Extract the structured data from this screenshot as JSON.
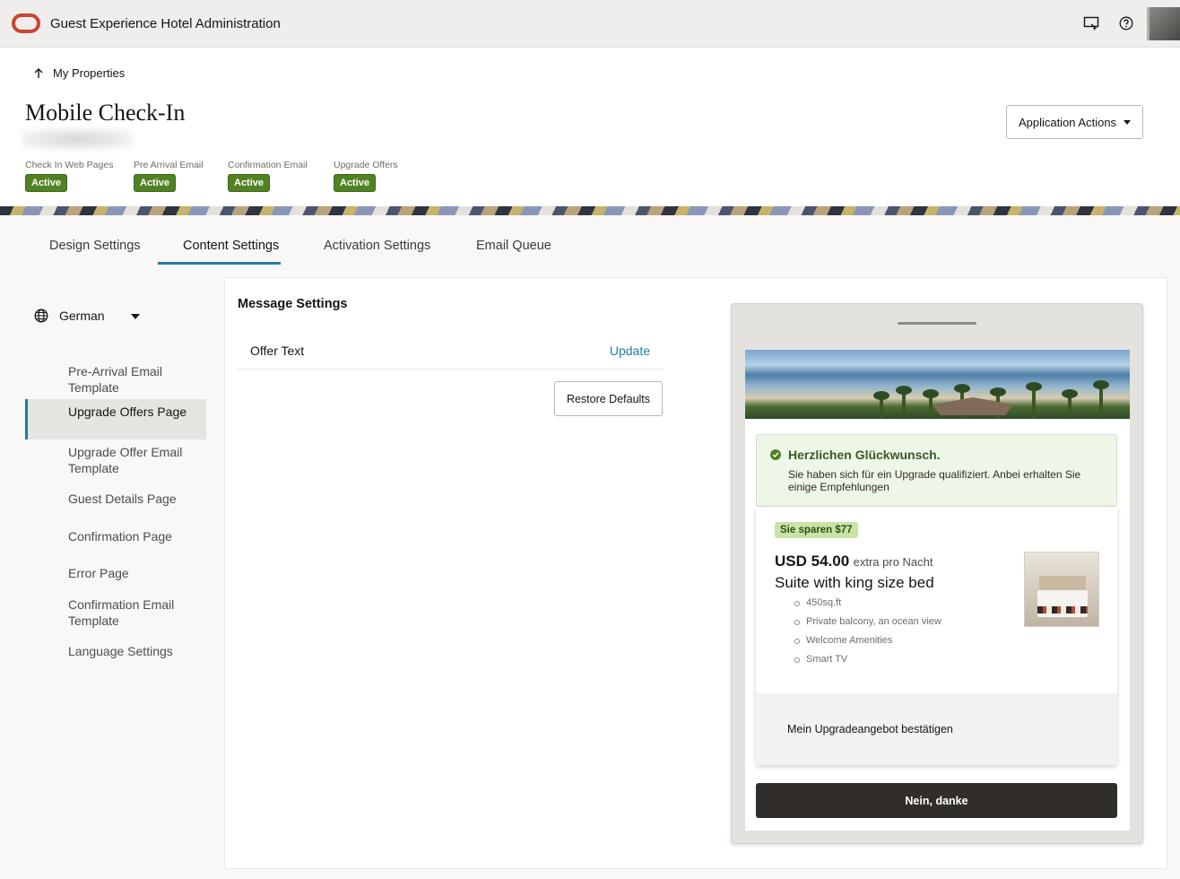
{
  "app": {
    "title": "Guest Experience Hotel Administration"
  },
  "header": {
    "back_label": "My Properties",
    "page_title": "Mobile Check-In",
    "actions_label": "Application Actions",
    "statuses": [
      {
        "label": "Check In Web Pages",
        "badge": "Active"
      },
      {
        "label": "Pre Arrival Email",
        "badge": "Active"
      },
      {
        "label": "Confirmation Email",
        "badge": "Active"
      },
      {
        "label": "Upgrade Offers",
        "badge": "Active"
      }
    ]
  },
  "tabs": [
    {
      "label": "Design Settings"
    },
    {
      "label": "Content Settings",
      "active": true
    },
    {
      "label": "Activation Settings"
    },
    {
      "label": "Email Queue"
    }
  ],
  "sidebar": {
    "language": "German",
    "items": [
      {
        "label": "Pre-Arrival Email Template"
      },
      {
        "label": "Upgrade Offers Page",
        "selected": true
      },
      {
        "label": "Upgrade Offer Email Template"
      },
      {
        "label": "Guest Details Page"
      },
      {
        "label": "Confirmation Page"
      },
      {
        "label": "Error Page"
      },
      {
        "label": "Confirmation Email Template"
      },
      {
        "label": "Language Settings"
      }
    ]
  },
  "main": {
    "section_title": "Message Settings",
    "offer_label": "Offer Text",
    "update_label": "Update",
    "restore_label": "Restore Defaults"
  },
  "preview": {
    "congrats_title": "Herzlichen Glückwunsch.",
    "congrats_text": "Sie haben sich für ein Upgrade qualifiziert. Anbei erhalten Sie einige Empfehlungen",
    "save_badge": "Sie sparen $77",
    "price": "USD 54.00",
    "price_extra": "extra pro Nacht",
    "room_name": "Suite with king size bed",
    "features": [
      "450sq.ft",
      "Private balcony, an ocean view",
      "Welcome Amenities",
      "Smart TV"
    ],
    "confirm_label": "Mein Upgradeangebot bestätigen",
    "decline_label": "Nein, danke"
  },
  "colors": {
    "accent": "#227e9e",
    "active_badge": "#508223",
    "logo": "#c74634",
    "dark_button": "#312d2a"
  }
}
